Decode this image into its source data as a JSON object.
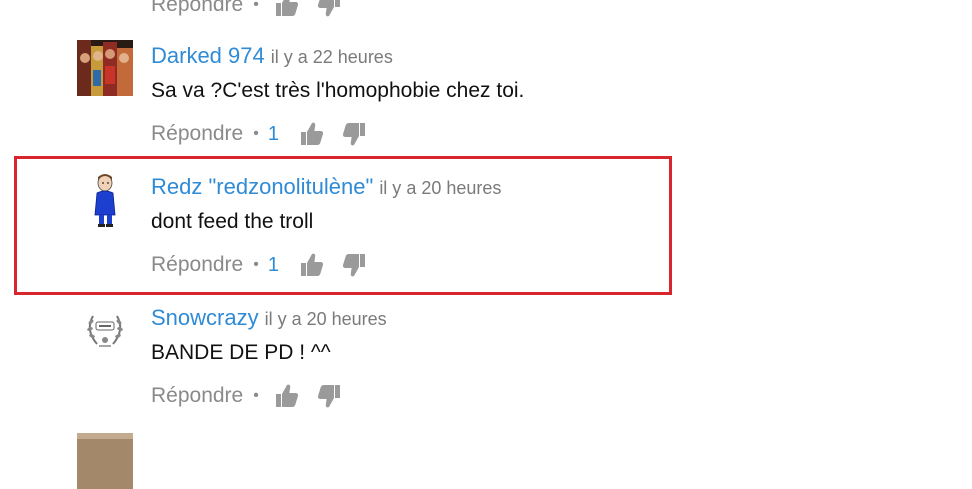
{
  "comments": [
    {
      "author": "",
      "time": "",
      "text": "",
      "reply_label": "Répondre",
      "likes": ""
    },
    {
      "author": "Darked 974",
      "time": "il y a 22 heures",
      "text": "Sa va ?C'est très l'homophobie chez toi.",
      "reply_label": "Répondre",
      "likes": "1",
      "avatar": "group-photo"
    },
    {
      "author": "Redz \"redzonolitulène\"",
      "time": "il y a 20 heures",
      "text": "dont feed the troll",
      "reply_label": "Répondre",
      "likes": "1",
      "highlighted": true,
      "avatar": "blue-figure-drawing"
    },
    {
      "author": "Snowcrazy",
      "time": "il y a 20 heures",
      "text": "BANDE DE PD ! ^^",
      "reply_label": "Répondre",
      "likes": "",
      "avatar": "laurel-emblem"
    },
    {
      "author": "",
      "time": "",
      "text": "",
      "reply_label": "",
      "likes": "",
      "avatar": "cut-off-photo"
    }
  ],
  "colors": {
    "author": "#2f8bd6",
    "meta": "#8a8a8a",
    "highlight_border": "#d7262d"
  },
  "icons": [
    "thumbs-up-icon",
    "thumbs-down-icon"
  ]
}
